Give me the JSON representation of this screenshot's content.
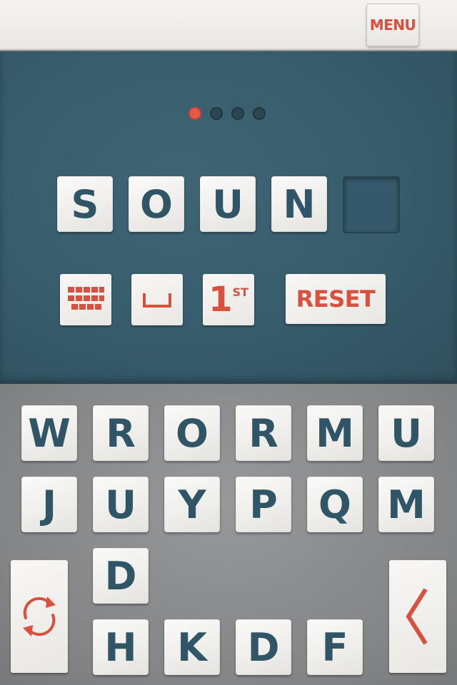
{
  "header": {
    "menu_label": "MENU"
  },
  "progress": {
    "total_dots": 4,
    "active_index": 0
  },
  "answer": {
    "letters": [
      "S",
      "O",
      "U",
      "N",
      ""
    ],
    "filled_count": 4,
    "total_slots": 5
  },
  "tools": {
    "keypad_icon": "grid-icon",
    "space_icon": "space-bracket-icon",
    "first_letter_label": "1",
    "first_letter_suffix": "ST",
    "reset_label": "RESET"
  },
  "keyboard": {
    "row1": [
      "W",
      "R",
      "O",
      "R",
      "M",
      "U"
    ],
    "row2": [
      "J",
      "U",
      "Y",
      "P",
      "Q",
      "M"
    ],
    "row3": [
      "D"
    ],
    "row4": [
      "H",
      "K",
      "D",
      "F"
    ],
    "shuffle_icon": "shuffle-arrows-icon",
    "back_icon": "chevron-left-icon"
  },
  "colors": {
    "accent_red": "#d9503f",
    "tile_text": "#2f5566",
    "board_bg": "#375c6c",
    "keyboard_bg": "#838587"
  }
}
